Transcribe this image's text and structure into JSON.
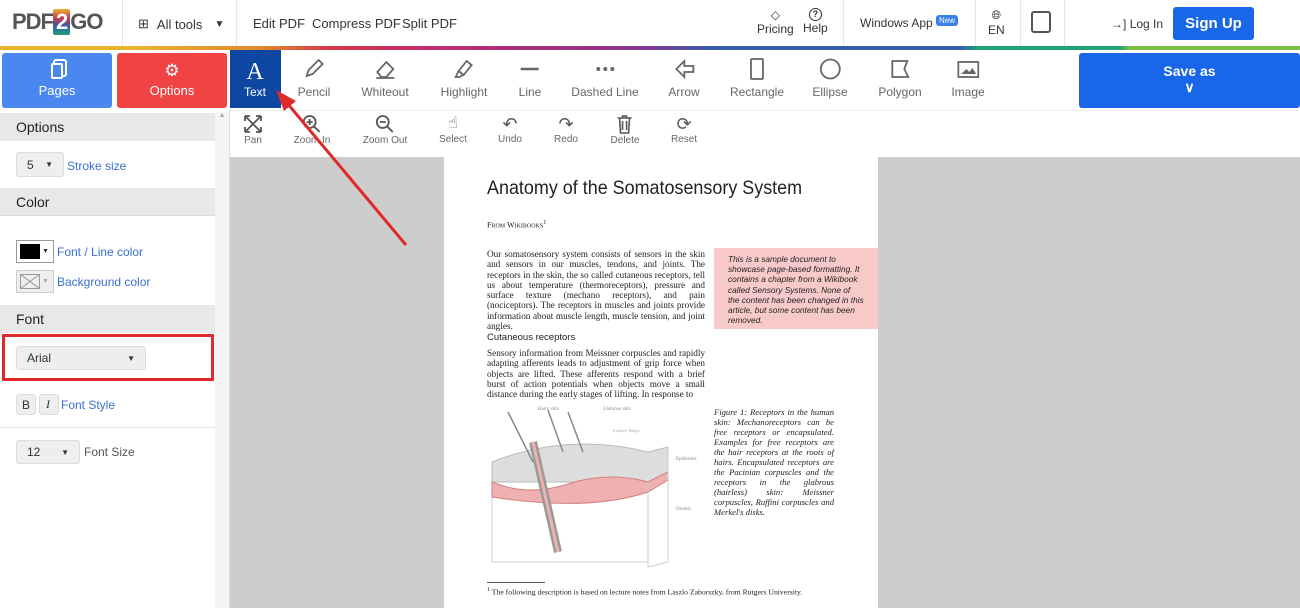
{
  "header": {
    "logo": "PDF2GO",
    "all_tools": "All tools",
    "nav": [
      "Edit PDF",
      "Compress PDF",
      "Split PDF"
    ],
    "pricing": "Pricing",
    "help": "Help",
    "windows_app": "Windows App",
    "new_badge": "New",
    "language": "EN",
    "login": "Log In",
    "signup": "Sign Up"
  },
  "left_buttons": {
    "pages": "Pages",
    "options": "Options"
  },
  "tools": [
    "Text",
    "Pencil",
    "Whiteout",
    "Highlight",
    "Line",
    "Dashed Line",
    "Arrow",
    "Rectangle",
    "Ellipse",
    "Polygon",
    "Image"
  ],
  "active_tool": "Text",
  "save_as": "Save as",
  "view_tools": [
    "Pan",
    "Zoom In",
    "Zoom Out",
    "Select",
    "Undo",
    "Redo",
    "Delete",
    "Reset"
  ],
  "sidebar": {
    "options_title": "Options",
    "stroke_value": "5",
    "stroke_label": "Stroke size",
    "color_title": "Color",
    "font_color_label": "Font / Line color",
    "font_color": "#000000",
    "bg_color_label": "Background color",
    "font_title": "Font",
    "font_value": "Arial",
    "bold": "B",
    "italic": "I",
    "font_style_label": "Font Style",
    "font_size_value": "12",
    "font_size_label": "Font Size"
  },
  "colors": {
    "brand_blue": "#1a66e8",
    "options_red": "#f04444",
    "active_tool": "#0d47a1",
    "highlight_box": "#e02a2a",
    "note_bg": "#f8c9c9"
  },
  "document": {
    "title": "Anatomy of the Somatosensory System",
    "byline": "From Wikibooks",
    "byline_sup": "1",
    "p1": "Our somatosensory system consists of sensors in the skin and sensors in our muscles, tendons, and joints. The receptors in the skin, the so called cutaneous receptors, tell us about temperature (thermoreceptors), pressure and surface texture (mechano receptors), and pain (nociceptors). The receptors in muscles and joints provide information about muscle length, muscle tension, and joint angles.",
    "note": "This is a sample document to showcase page-based formatting. It contains a chapter from a Wikibook called Sensory Systems. None of the content has been changed in this article, but some content has been removed.",
    "h2": "Cutaneous receptors",
    "p2": "Sensory information from Meissner corpuscles and rapidly adapting afferents leads to adjustment of grip force when objects are lifted. These afferents respond with a brief burst of action potentials when objects move a small distance during the early stages of lifting. In response to",
    "figure_labels": [
      "Hairy skin",
      "Glabrous skin",
      "Papillary Ridges",
      "Epidermis",
      "Dermis"
    ],
    "caption": "Figure 1: Receptors in the human skin: Mechanoreceptors can be free receptors or encapsulated. Examples for free receptors are the hair receptors at the roots of hairs. Encapsulated receptors are the Pacinian corpuscles and the receptors in the glabrous (hairless) skin: Meissner corpuscles, Ruffini corpuscles and Merkel's disks.",
    "footnote_num": "1",
    "footnote": "The following description is based on lecture notes from Laszlo Zaborszky, from Rutgers University."
  }
}
